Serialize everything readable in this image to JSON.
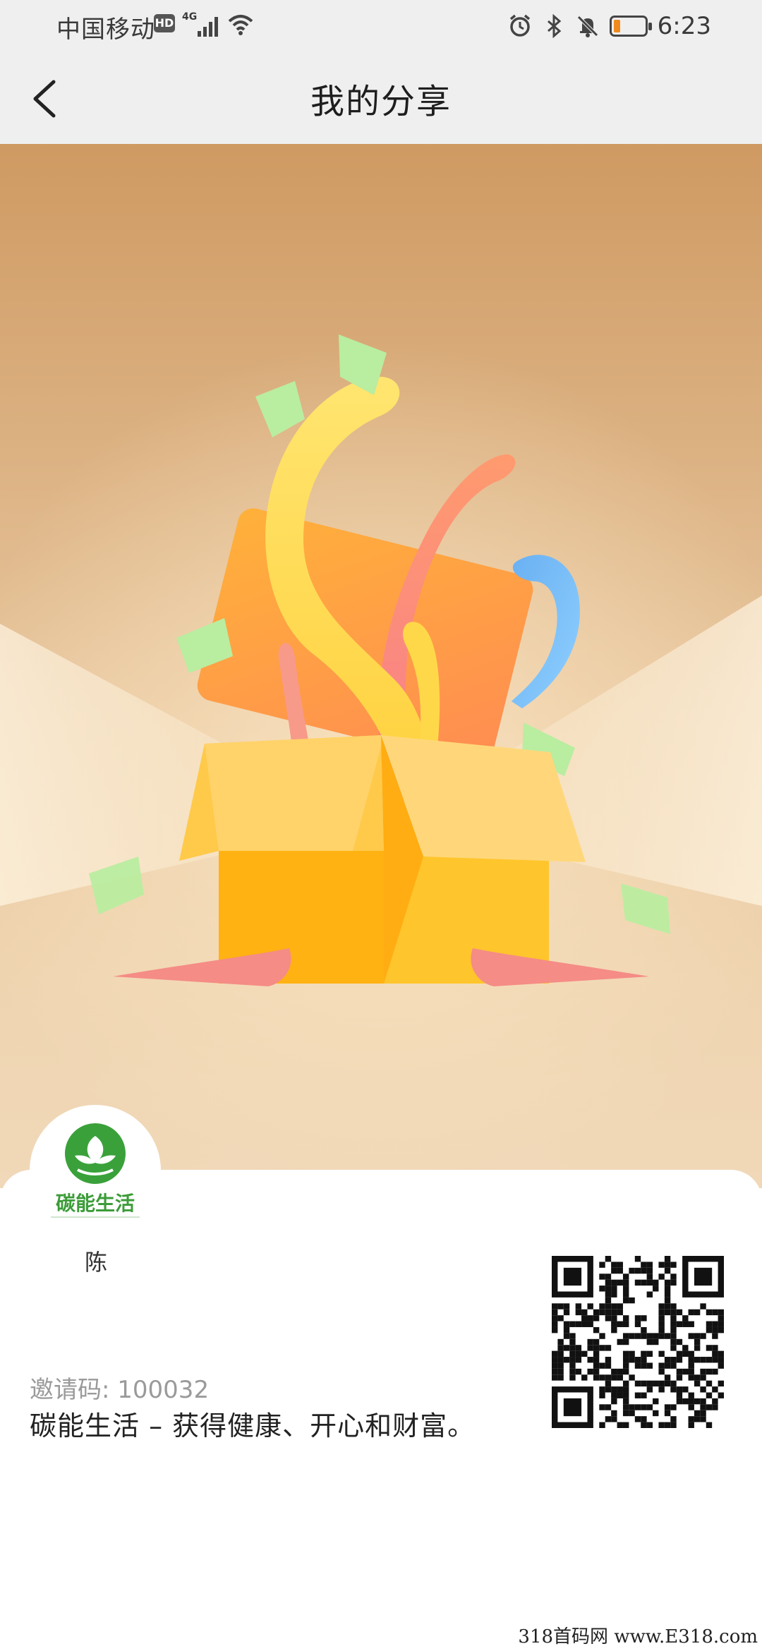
{
  "status_bar": {
    "carrier": "中国移动",
    "hd_badge": "HD",
    "network": "4G",
    "time": "6:23",
    "icons": [
      "alarm-icon",
      "bluetooth-icon",
      "mute-bell-icon",
      "battery-low-icon"
    ],
    "battery_color": "#f08a1e"
  },
  "nav": {
    "title": "我的分享",
    "back_icon": "chevron-left-icon"
  },
  "hero": {
    "illustration": "gift-box-with-ribbons",
    "colors": {
      "background_top": "#cf9a62",
      "box": "#ffc02e",
      "box_lid": "#ff9c4a",
      "ribbon_pink": "#f58c86",
      "ribbon_blue": "#6fb3f0",
      "confetti": "#b8eb9c"
    }
  },
  "profile": {
    "logo_text": "碳能生活",
    "logo_color": "#3c9c39",
    "user_name": "陈"
  },
  "share": {
    "invite_label": "邀请码:",
    "invite_code": "100032",
    "slogan": "碳能生活 – 获得健康、开心和财富。"
  },
  "watermark": "318首码网 www.E318.com"
}
